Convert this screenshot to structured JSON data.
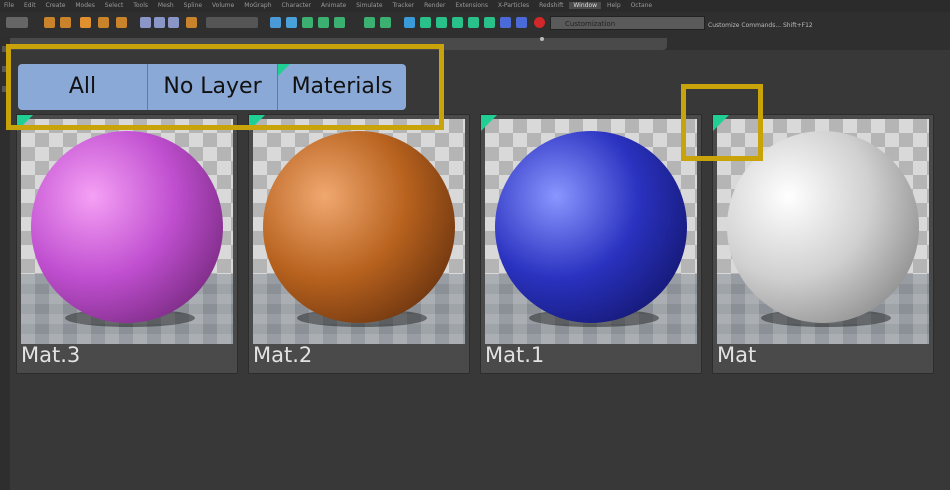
{
  "menubar": {
    "items": [
      "File",
      "Edit",
      "Create",
      "Modes",
      "Select",
      "Tools",
      "Mesh",
      "Spline",
      "Volume",
      "MoGraph",
      "Character",
      "Animate",
      "Simulate",
      "Tracker",
      "Render",
      "Extensions",
      "X-Particles",
      "Redshift",
      "Window",
      "Help",
      "Octane"
    ],
    "active": "Window"
  },
  "toolbar": {
    "layout": "Customization",
    "custom_label": "Customize Commands...   Shift+F12"
  },
  "filter_tabs": [
    "All",
    "No Layer",
    "Materials"
  ],
  "materials": [
    {
      "name": "Mat.3",
      "color": "#c04fd0",
      "highlight": "#f5a0f5",
      "dark": "#5a1a60"
    },
    {
      "name": "Mat.2",
      "color": "#b8621e",
      "highlight": "#f0a870",
      "dark": "#4a2008"
    },
    {
      "name": "Mat.1",
      "color": "#2a32c0",
      "highlight": "#8a96ff",
      "dark": "#0a0c50"
    },
    {
      "name": "Mat",
      "color": "#d0d0d0",
      "highlight": "#ffffff",
      "dark": "#707070"
    }
  ],
  "colors": {
    "tab_fill": "#8ba9d6",
    "assigned_marker": "#1fcf93",
    "highlight_box": "#c9a30a"
  }
}
